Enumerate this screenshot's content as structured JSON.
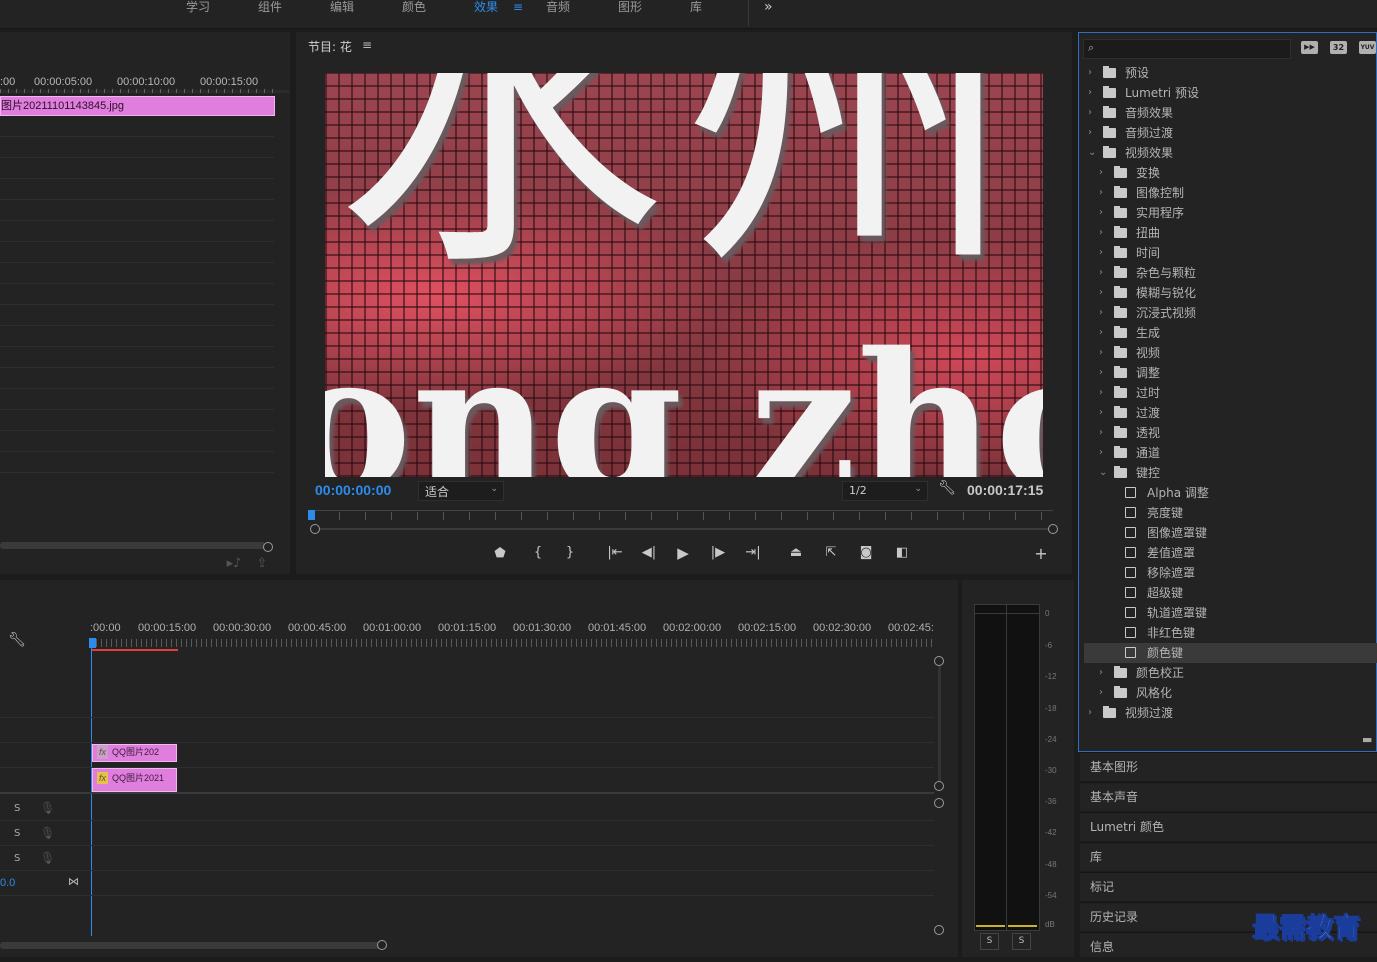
{
  "workspace_tabs": [
    "学习",
    "组件",
    "编辑",
    "颜色",
    "效果",
    "音频",
    "图形",
    "库"
  ],
  "active_tab": "效果",
  "more_symbol": "»",
  "menu_symbol": "≡",
  "source": {
    "ruler_labels": [
      ":00",
      "00:00:05:00",
      "00:00:10:00",
      "00:00:15:00"
    ],
    "clip_name": "图片20211101143845.jpg"
  },
  "program": {
    "title": "节目: 花",
    "timecode": "00:00:00:00",
    "zoom": "适合",
    "resolution": "1/2",
    "duration": "00:00:17:15",
    "image_text_top": "水州",
    "image_text_bottom": "ong zho"
  },
  "timeline": {
    "ruler_labels": [
      ":00:00",
      "00:00:15:00",
      "00:00:30:00",
      "00:00:45:00",
      "00:01:00:00",
      "00:01:15:00",
      "00:01:30:00",
      "00:01:45:00",
      "00:02:00:00",
      "00:02:15:00",
      "00:02:30:00",
      "00:02:45:"
    ],
    "clip1": "QQ图片202",
    "clip2": "QQ图片2021",
    "fx_label": "fx",
    "solo_label": "S",
    "master_value": "0.0"
  },
  "meter": {
    "scale": [
      "0",
      "-6",
      "-12",
      "-18",
      "-24",
      "-30",
      "-36",
      "-42",
      "-48",
      "-54",
      "dB"
    ],
    "solo_labels": [
      "S",
      "S"
    ]
  },
  "effects": {
    "search_placeholder": "",
    "badge_32": "32",
    "badge_yuv": "YUV",
    "tree": [
      {
        "label": "预设",
        "level": 0,
        "kind": "folder"
      },
      {
        "label": "Lumetri 预设",
        "level": 0,
        "kind": "folder"
      },
      {
        "label": "音频效果",
        "level": 0,
        "kind": "folder"
      },
      {
        "label": "音频过渡",
        "level": 0,
        "kind": "folder"
      },
      {
        "label": "视频效果",
        "level": 0,
        "kind": "folder",
        "open": true
      },
      {
        "label": "变换",
        "level": 1,
        "kind": "folder"
      },
      {
        "label": "图像控制",
        "level": 1,
        "kind": "folder"
      },
      {
        "label": "实用程序",
        "level": 1,
        "kind": "folder"
      },
      {
        "label": "扭曲",
        "level": 1,
        "kind": "folder"
      },
      {
        "label": "时间",
        "level": 1,
        "kind": "folder"
      },
      {
        "label": "杂色与颗粒",
        "level": 1,
        "kind": "folder"
      },
      {
        "label": "模糊与锐化",
        "level": 1,
        "kind": "folder"
      },
      {
        "label": "沉浸式视频",
        "level": 1,
        "kind": "folder"
      },
      {
        "label": "生成",
        "level": 1,
        "kind": "folder"
      },
      {
        "label": "视频",
        "level": 1,
        "kind": "folder"
      },
      {
        "label": "调整",
        "level": 1,
        "kind": "folder"
      },
      {
        "label": "过时",
        "level": 1,
        "kind": "folder"
      },
      {
        "label": "过渡",
        "level": 1,
        "kind": "folder"
      },
      {
        "label": "透视",
        "level": 1,
        "kind": "folder"
      },
      {
        "label": "通道",
        "level": 1,
        "kind": "folder"
      },
      {
        "label": "键控",
        "level": 1,
        "kind": "folder",
        "open": true
      },
      {
        "label": "Alpha 调整",
        "level": 2,
        "kind": "effect"
      },
      {
        "label": "亮度键",
        "level": 2,
        "kind": "effect"
      },
      {
        "label": "图像遮罩键",
        "level": 2,
        "kind": "effect"
      },
      {
        "label": "差值遮罩",
        "level": 2,
        "kind": "effect"
      },
      {
        "label": "移除遮罩",
        "level": 2,
        "kind": "effect"
      },
      {
        "label": "超级键",
        "level": 2,
        "kind": "effect"
      },
      {
        "label": "轨道遮罩键",
        "level": 2,
        "kind": "effect"
      },
      {
        "label": "非红色键",
        "level": 2,
        "kind": "effect"
      },
      {
        "label": "颜色键",
        "level": 2,
        "kind": "effect",
        "selected": true
      },
      {
        "label": "颜色校正",
        "level": 1,
        "kind": "folder"
      },
      {
        "label": "风格化",
        "level": 1,
        "kind": "folder"
      },
      {
        "label": "视频过渡",
        "level": 0,
        "kind": "folder"
      }
    ]
  },
  "accordion_panels": [
    "基本图形",
    "基本声音",
    "Lumetri 颜色",
    "库",
    "标记",
    "历史记录",
    "信息"
  ],
  "watermark": "最需教育",
  "colors": {
    "accent": "#2d8ceb",
    "clip": "#e07ede",
    "playhead": "#2d8ceb",
    "selection": "#3a3a3a"
  }
}
